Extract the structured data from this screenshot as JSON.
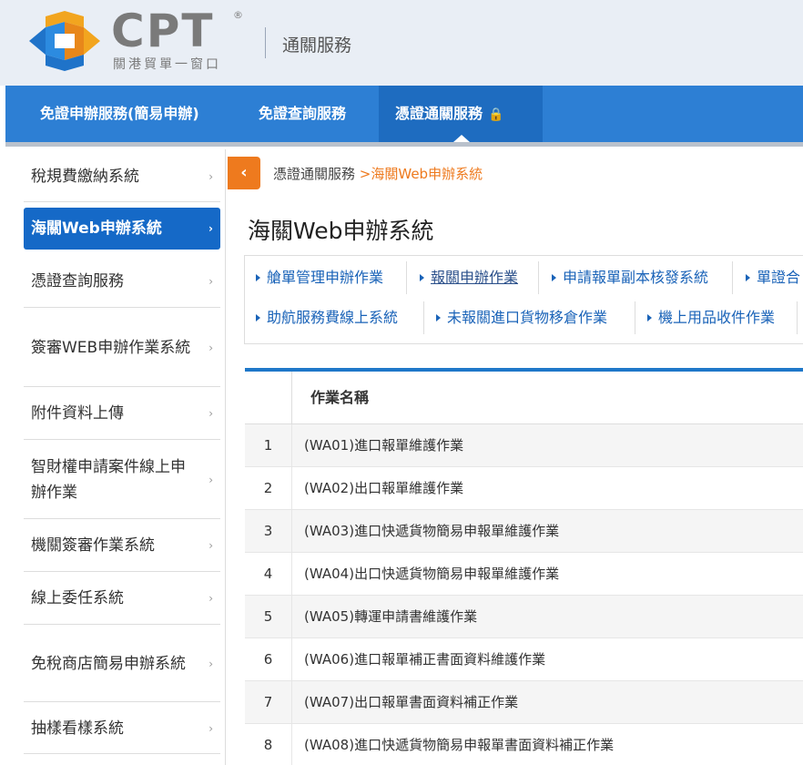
{
  "header": {
    "brand": "CPT",
    "registered_mark": "®",
    "brand_subtitle": "關港貿單一窗口",
    "service_title": "通關服務"
  },
  "colors": {
    "primary": "#2d7fd4",
    "active": "#1569c7",
    "accent": "#ee7a1e",
    "link": "#1a63b8"
  },
  "nav": {
    "items": [
      {
        "label": "免證申辦服務(簡易申辦)"
      },
      {
        "label": "免證查詢服務"
      },
      {
        "label": "憑證通關服務",
        "icon": "lock-icon",
        "active": true
      }
    ]
  },
  "sidebar": {
    "items": [
      {
        "label": "稅規費繳納系統"
      },
      {
        "label": "海關Web申辦系統",
        "active": true
      },
      {
        "label": "憑證查詢服務"
      },
      {
        "label": "簽審WEB申辦作業系統"
      },
      {
        "label": "附件資料上傳"
      },
      {
        "label": "智財權申請案件線上申辦作業"
      },
      {
        "label": "機關簽審作業系統"
      },
      {
        "label": "線上委任系統"
      },
      {
        "label": "免稅商店簡易申辦系統"
      },
      {
        "label": "抽樣看樣系統"
      }
    ]
  },
  "breadcrumb": {
    "parent": "憑證通關服務",
    "separator": ">",
    "current": "海關Web申辦系統"
  },
  "page_title": "海關Web申辦系統",
  "subnav": {
    "items": [
      {
        "label": "艙單管理申辦作業"
      },
      {
        "label": "報關申辦作業",
        "selected": true
      },
      {
        "label": "申請報單副本核發系統"
      },
      {
        "label": "單證合"
      },
      {
        "label": "助航服務費線上系統"
      },
      {
        "label": "未報關進口貨物移倉作業"
      },
      {
        "label": "機上用品收件作業"
      }
    ]
  },
  "table": {
    "header": "作業名稱",
    "rows": [
      {
        "no": "1",
        "name": "(WA01)進口報單維護作業"
      },
      {
        "no": "2",
        "name": "(WA02)出口報單維護作業"
      },
      {
        "no": "3",
        "name": "(WA03)進口快遞貨物簡易申報單維護作業"
      },
      {
        "no": "4",
        "name": "(WA04)出口快遞貨物簡易申報單維護作業"
      },
      {
        "no": "5",
        "name": "(WA05)轉運申請書維護作業"
      },
      {
        "no": "6",
        "name": "(WA06)進口報單補正書面資料維護作業"
      },
      {
        "no": "7",
        "name": "(WA07)出口報單書面資料補正作業"
      },
      {
        "no": "8",
        "name": "(WA08)進口快遞貨物簡易申報單書面資料補正作業"
      }
    ]
  }
}
